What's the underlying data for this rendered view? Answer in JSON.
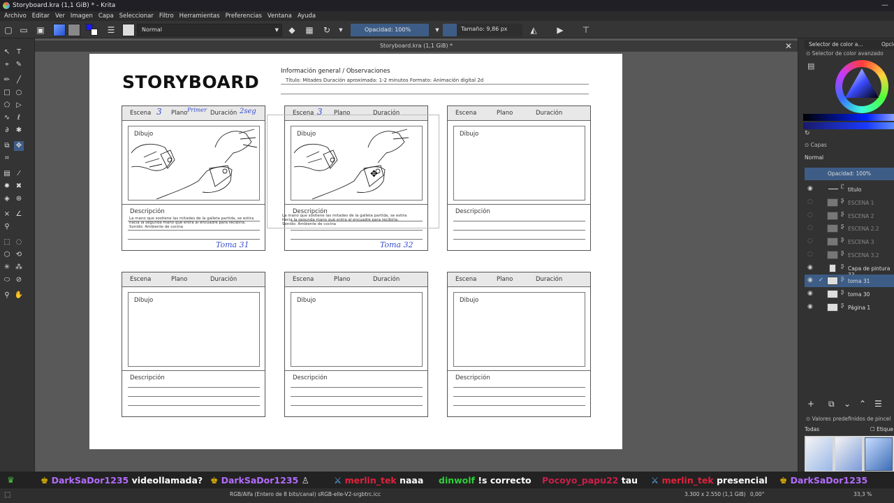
{
  "window": {
    "title": "Storyboard.kra (1,1 GiB) * - Krita"
  },
  "menu": [
    "Archivo",
    "Editar",
    "Ver",
    "Imagen",
    "Capa",
    "Seleccionar",
    "Filtro",
    "Herramientas",
    "Preferencias",
    "Ventana",
    "Ayuda"
  ],
  "toolbar": {
    "blend_mode": "Normal",
    "opacity": "Opacidad: 100%",
    "size": "Tamaño: 9,86 px",
    "fg_color": "#1a1aff",
    "bg_color": "#ffffff"
  },
  "document_tab": {
    "title": "Storyboard.kra (1,1 GiB) *"
  },
  "storyboard": {
    "title": "STORYBOARD",
    "info_heading": "Información general / Observaciones",
    "info_line": "Título: Mitades Duración aproximada: 1-2 minutos Formato: Animación digital 2d",
    "labels": {
      "escena": "Escena",
      "plano": "Plano",
      "duracion": "Duración",
      "dibujo": "Dibujo",
      "descripcion": "Descripción"
    },
    "frame1": {
      "escena_hw": "3",
      "plano_hw": "Primer",
      "duracion_hw": "2seg",
      "description": [
        "La mano que sostiene las mitades de la galleta partida, se estira",
        "hacia la segunda mano que entra al encuadre para recibirla.",
        "Sonido: Ambiente de cocina"
      ],
      "toma": "Toma 31"
    },
    "frame2": {
      "escena_hw": "3",
      "description": [
        "La mano que sostiene las mitades de la galleta partida, se estira",
        "hacia la segunda mano que entra al encuadre para recibirla.",
        "Sonido: Ambiente de cocina"
      ],
      "toma": "Toma 32"
    }
  },
  "right_panel": {
    "color_tab": "Selector de color a...",
    "options_tab": "Opcione",
    "color_selector_title": "Selector de color avanzado",
    "layers_title": "Capas",
    "layers_mode": "Normal",
    "layers_opacity": "Opacidad:  100%",
    "layers": [
      {
        "name": "titulo",
        "visible": true,
        "dim": false
      },
      {
        "name": "ESCENA 1",
        "visible": false,
        "dim": true
      },
      {
        "name": "ESCENA 2",
        "visible": false,
        "dim": true
      },
      {
        "name": "ESCENA 2.2",
        "visible": false,
        "dim": true
      },
      {
        "name": "ESCENA 3",
        "visible": false,
        "dim": true
      },
      {
        "name": "ESCENA 3.2",
        "visible": false,
        "dim": true
      },
      {
        "name": "Capa de pintura 33",
        "visible": true,
        "dim": false
      },
      {
        "name": "toma 31",
        "visible": true,
        "dim": false,
        "selected": true
      },
      {
        "name": "toma 30",
        "visible": true,
        "dim": false
      },
      {
        "name": "Página 1",
        "visible": true,
        "dim": false
      }
    ],
    "brush_presets_title": "Valores predefinidos de pincel",
    "brush_filter": "Todas",
    "brush_tag": "Etique"
  },
  "chat": [
    {
      "user": "DarkSaDor1235",
      "msg": "videollamada?",
      "color": "#b46cff"
    },
    {
      "user": "DarkSaDor1235",
      "msg": "",
      "color": "#b46cff"
    },
    {
      "user": "merlin_tek",
      "msg": "naaa",
      "color": "#e0213b"
    },
    {
      "user": "dinwolf",
      "msg": "!s correcto",
      "color": "#2ecf3a"
    },
    {
      "user": "Pocoyo_papu22",
      "msg": "tau",
      "color": "#c8204a"
    },
    {
      "user": "merlin_tek",
      "msg": "presencial",
      "color": "#e0213b"
    },
    {
      "user": "DarkSaDor1235",
      "msg": "",
      "color": "#b46cff"
    }
  ],
  "status": {
    "color_space": "RGB/Alfa (Entero de 8 bits/canal)  sRGB-elle-V2-srgbtrc.icc",
    "dimensions": "3.300 x 2.550 (1,1 GiB)",
    "rotation": "0,00°",
    "zoom": "33,3 %"
  }
}
